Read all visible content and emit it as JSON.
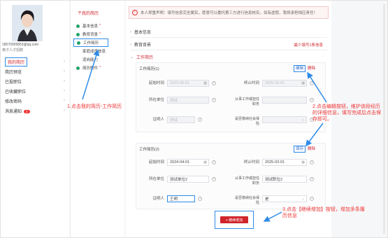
{
  "user": {
    "name": "18570005853@qq.com",
    "company": "英才人才招聘"
  },
  "nav": {
    "items": [
      {
        "label": "我的简历"
      },
      {
        "label": "简历预览"
      },
      {
        "label": "已投职位"
      },
      {
        "label": "已收藏职位"
      },
      {
        "label": "修改密码"
      },
      {
        "label": "消息通知",
        "badge": "2"
      }
    ]
  },
  "sub": {
    "title": "〒我的简历",
    "items": [
      {
        "label": "基本信息",
        "req": "*"
      },
      {
        "label": "教育背景",
        "req": "*"
      },
      {
        "label": "工作简历",
        "req": ""
      },
      {
        "label": "家庭成员信息",
        "req": ""
      },
      {
        "label": "适岗能力",
        "req": ""
      },
      {
        "label": "简历附件",
        "req": "*"
      }
    ]
  },
  "notice": "本人郑重声明：填写信息完全属实，愿意可以委托第三方进行信息核实，如有虚假，我将承担相应责任！",
  "sections": {
    "basic": "基本信息",
    "edu": "教育背景",
    "work": "工作简历",
    "edu_note": "最少填写1条信息"
  },
  "work1": {
    "title": "工作简历(1)",
    "edit": "编辑",
    "delete": "删除",
    "start_label": "起始时间",
    "start_value": "2023-06-01",
    "end_label": "终止时间",
    "end_value": "2025-02-01",
    "unit_label": "所在单位",
    "unit_value": "测试",
    "related_label": "从事工作或担任职务",
    "related_value": "",
    "ref_label": "证明人",
    "ref_value": "测试",
    "insured_label": "是否缴纳社会保险",
    "insured_value": ""
  },
  "work2": {
    "title": "工作简历(2)",
    "save": "保存",
    "delete": "删除",
    "start_label": "起始时间",
    "start_value": "2024-04-01",
    "end_label": "终止时间",
    "end_value": "2025-03-01",
    "unit_label": "所在单位",
    "unit_value": "测试单位2",
    "related_label": "从事工作或担任职务",
    "related_value": "测试职位2",
    "ref_label": "证明人",
    "ref_value": "王明",
    "insured_label": "是否缴纳社会保险",
    "insured_value": "是"
  },
  "add_button": "+ 继续增加",
  "annotations": {
    "a1": "1.点击我的简历-工作简历",
    "a2": "2.点击编辑按钮，维护该段经历的详细信息，填写完成后点击保存即可。",
    "a3": "3.点击【继续增加】按钮，增加多条履历信息"
  },
  "colors": {
    "accent": "#d0242c",
    "annot": "#e33333",
    "highlight": "#2f8be8"
  }
}
